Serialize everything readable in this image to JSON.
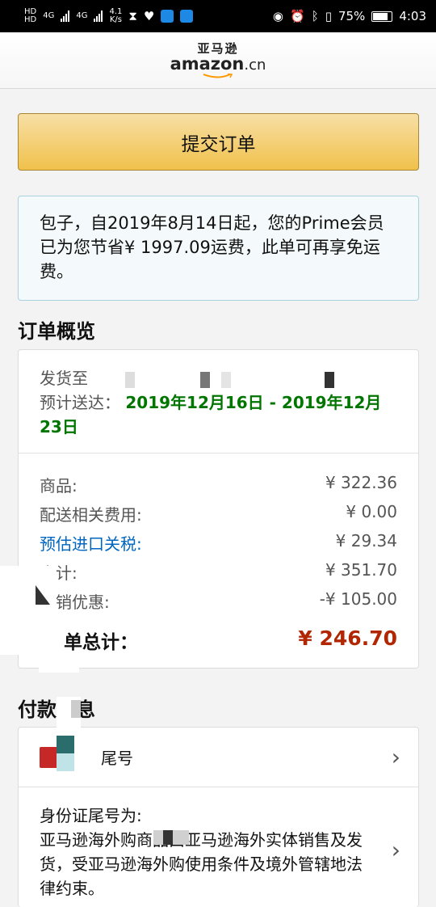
{
  "status_bar": {
    "network_label_1": "HD",
    "network_label_2": "HD",
    "net_type_1": "4G",
    "net_type_2": "4G",
    "speed_value": "4.1",
    "speed_unit": "K/s",
    "battery_percent": "75%",
    "time": "4:03"
  },
  "header": {
    "logo_cn": "亚马逊",
    "logo_en": "amazon",
    "logo_suffix": ".cn"
  },
  "submit_button": {
    "label": "提交订单"
  },
  "prime_notice": {
    "text": "包子，自2019年8月14日起，您的Prime会员已为您节省¥ 1997.09运费，此单可再享免运费。"
  },
  "order_summary": {
    "title": "订单概览",
    "ship_to_label": "发货至",
    "delivery_label": "预计送达：",
    "delivery_date": "2019年12月16日 - 2019年12月23日",
    "rows": [
      {
        "label": "商品:",
        "value": "¥ 322.36",
        "link": false
      },
      {
        "label": "配送相关费用:",
        "value": "¥ 0.00",
        "link": false
      },
      {
        "label": "预估进口关税:",
        "value": "¥ 29.34",
        "link": true
      },
      {
        "label": "小计:",
        "value": "¥ 351.70",
        "link": false
      },
      {
        "label": "促销优惠:",
        "value": "-¥ 105.00",
        "link": false
      }
    ],
    "total_label": "单总计：",
    "total_value": "¥ 246.70"
  },
  "payment": {
    "title": "付款信息",
    "card_label": "尾号",
    "id_label": "身份证尾号为:",
    "disclaimer": "亚马逊海外购商品由亚马逊海外实体销售及发货，受亚马逊海外购使用条件及境外管辖地法律约束。"
  }
}
